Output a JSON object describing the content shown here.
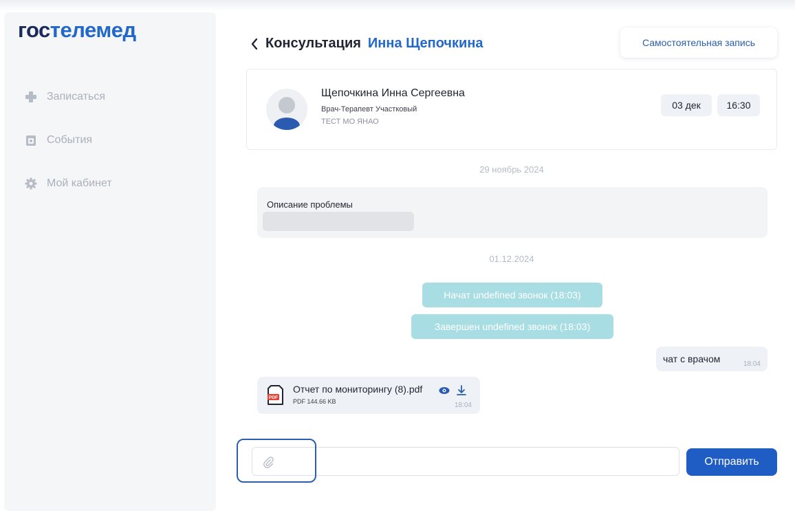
{
  "logo": {
    "part1": "гос",
    "part2": "телемед"
  },
  "sidebar": {
    "items": [
      {
        "label": "Записаться",
        "icon": "plus-icon"
      },
      {
        "label": "События",
        "icon": "calendar-icon"
      },
      {
        "label": "Мой кабинет",
        "icon": "gear-icon"
      }
    ]
  },
  "header": {
    "title_prefix": "Консультация",
    "title_name": "Инна Щепочкина",
    "self_record_label": "Самостоятельная запись"
  },
  "doctor": {
    "name": "Щепочкина Инна Сергеевна",
    "role": "Врач-Терапевт Участковый",
    "org": "ТЕСТ МО ЯНАО",
    "date": "03 дек",
    "time": "16:30"
  },
  "chat": {
    "date1": "29 ноябрь 2024",
    "problem_label": "Описание проблемы",
    "date2": "01.12.2024",
    "system1": "Начат undefined звонок (18:03)",
    "system2": "Завершен undefined звонок (18:03)",
    "outgoing_text": "чат с врачом",
    "outgoing_time": "18:04",
    "file_name": "Отчет по мониторингу (8).pdf",
    "file_size": "PDF 144.66 KB",
    "file_time": "18:04",
    "file_badge": "PDF"
  },
  "composer": {
    "placeholder": "",
    "send_label": "Отправить"
  },
  "colors": {
    "accent": "#1f5cc4",
    "brand_dark": "#1b2a5c",
    "brand_blue": "#2268c9",
    "system_msg": "#a8dde3"
  }
}
